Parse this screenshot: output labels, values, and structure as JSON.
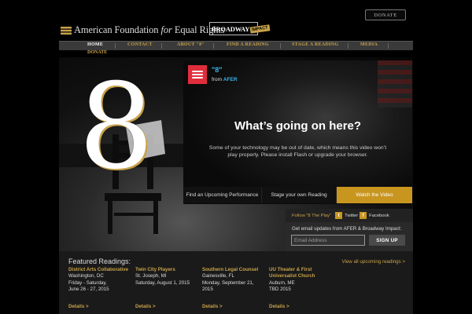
{
  "header": {
    "org_name_part1": "American Foundation",
    "org_name_for": "for",
    "org_name_part2": "Equal Rights",
    "broadway_logo": "BROADWAY",
    "broadway_impact": "IMPACT",
    "donate_label": "DONATE"
  },
  "nav": {
    "items": [
      {
        "label": "HOME",
        "active": true
      },
      {
        "label": "CONTACT"
      },
      {
        "label": "ABOUT \"8\""
      },
      {
        "label": "FIND A READING"
      },
      {
        "label": "STAGE A READING"
      },
      {
        "label": "MEDIA"
      }
    ],
    "donate": "DONATE"
  },
  "hero": {
    "big_number": "8"
  },
  "video": {
    "title": "\"8\"",
    "from_prefix": "from",
    "from_source": "AFER",
    "heading": "What’s going on here?",
    "message": "Some of your technology may be out of date, which means this video won’t play properly. Please install Flash or upgrade your browser."
  },
  "tabs": [
    {
      "label": "Find an Upcoming Performance"
    },
    {
      "label": "Stage your own Reading"
    },
    {
      "label": "Watch the Video"
    }
  ],
  "social": {
    "follow_label": "Follow \"8 The Play\"",
    "twitter_label": "Twitter",
    "facebook_label": "Facebook",
    "email_label": "Get email updates from AFER & Broadway Impact:",
    "email_placeholder": "Email Address",
    "signup_label": "SIGN UP"
  },
  "featured": {
    "title": "Featured Readings:",
    "view_all": "View all upcoming readings >",
    "details_label": "Details >",
    "readings": [
      {
        "name": "District Arts Collaborative",
        "lines": [
          "Washington, DC",
          "Friday - Saturday,",
          "June 26 - 27, 2015"
        ]
      },
      {
        "name": "Twin City Players",
        "lines": [
          "St. Joseph, MI",
          "Saturday, August 1, 2015"
        ]
      },
      {
        "name": "Southern Legal Counsel",
        "lines": [
          "Gainesville, FL",
          "Monday, September 21,",
          "2015"
        ]
      },
      {
        "name": "UU Theater & First Universalist Church",
        "lines": [
          "Auburn, ME",
          "TBD 2015"
        ]
      }
    ]
  },
  "colors": {
    "gold": "#c8a24a",
    "tab_gold": "#c8961f",
    "afer_red": "#e02d3c",
    "link_blue": "#3ab4e6"
  }
}
